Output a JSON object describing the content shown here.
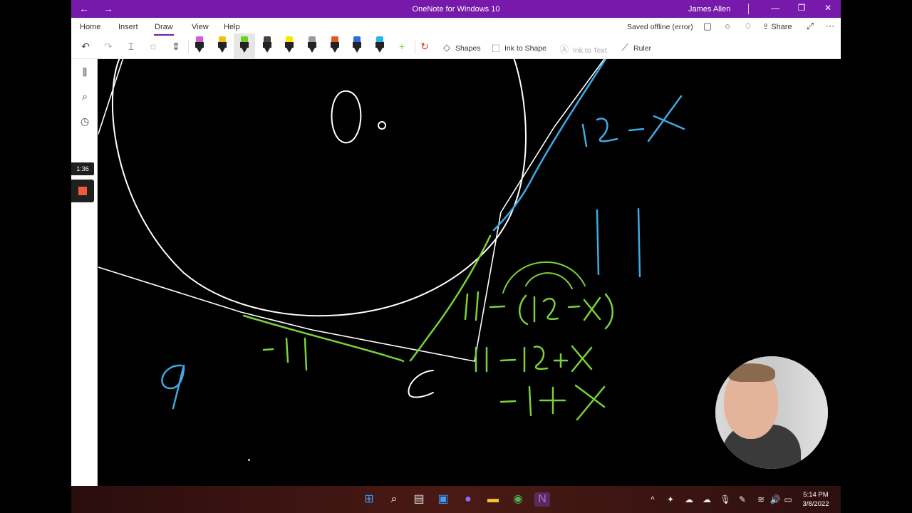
{
  "window": {
    "title": "OneNote for Windows 10",
    "user": "James Allen",
    "nav_back": "←",
    "nav_forward": "→",
    "minimize": "—",
    "maximize": "❐",
    "close": "✕"
  },
  "ribbon": {
    "tabs": [
      "Home",
      "Insert",
      "Draw",
      "View",
      "Help"
    ],
    "active_tab": "Draw",
    "status": "Saved offline (error)",
    "share_label": "Share",
    "tools": {
      "shapes_label": "Shapes",
      "ink_to_shape_label": "Ink to Shape",
      "ink_to_text_label": "Ink to Text",
      "ruler_label": "Ruler",
      "add_pen": "+"
    },
    "pens": [
      {
        "color": "#d05fd4"
      },
      {
        "color": "#f2c012"
      },
      {
        "color": "#6cd21f"
      },
      {
        "color": "#444444"
      },
      {
        "color": "#ffe600"
      },
      {
        "color": "#9a9a9a"
      },
      {
        "color": "#e05a1f"
      },
      {
        "color": "#2d6bd6"
      },
      {
        "color": "#29b6e8"
      }
    ],
    "selected_pen_color": "#6cd21f"
  },
  "recording": {
    "timer": "1:36"
  },
  "canvas": {
    "ink_colors": {
      "white": "#ffffff",
      "blue": "#3fa9e6",
      "green": "#7ad23a"
    },
    "handwriting": {
      "point_label": "O",
      "tangent_top_label": "12-X",
      "side_label": "11",
      "expr1": "11-(12-X)",
      "expr2": "11-12+X",
      "expr3": "-1+X",
      "bottom_segment_label": "-11",
      "left_label": "9",
      "vertex_label": "C"
    }
  },
  "taskbar": {
    "clock_time": "5:14 PM",
    "clock_date": "3/8/2022"
  }
}
